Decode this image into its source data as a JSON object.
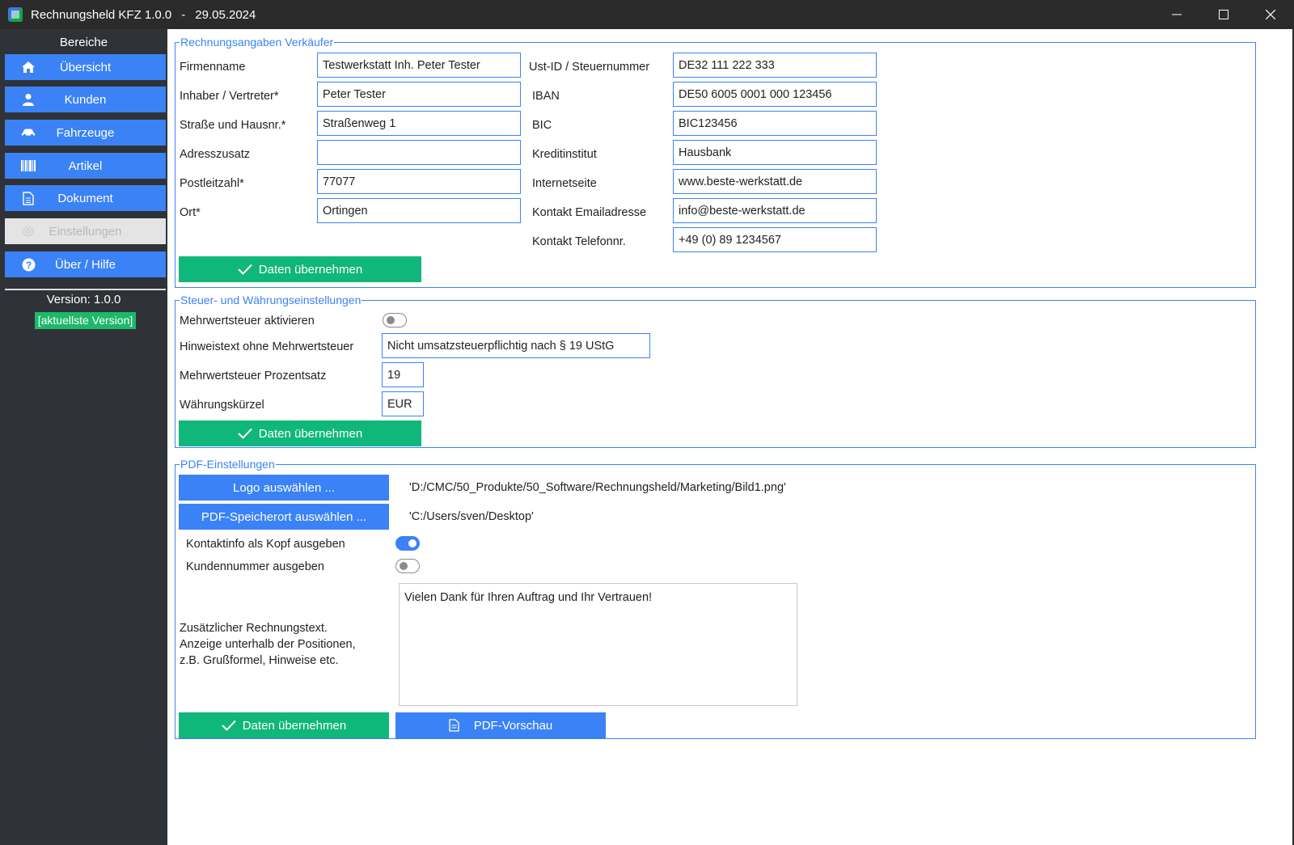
{
  "window": {
    "app_title": "Rechnungsheld KFZ 1.0.0",
    "separator": "-",
    "date": "29.05.2024"
  },
  "sidebar": {
    "heading": "Bereiche",
    "items": [
      {
        "label": "Übersicht",
        "icon": "home-icon"
      },
      {
        "label": "Kunden",
        "icon": "user-icon"
      },
      {
        "label": "Fahrzeuge",
        "icon": "car-icon"
      },
      {
        "label": "Artikel",
        "icon": "barcode-icon"
      },
      {
        "label": "Dokument",
        "icon": "document-icon"
      },
      {
        "label": "Einstellungen",
        "icon": "gear-icon"
      },
      {
        "label": "Über / Hilfe",
        "icon": "help-icon"
      }
    ],
    "version": "Version: 1.0.0",
    "version_status": "[aktuellste Version]"
  },
  "seller": {
    "legend": "Rechnungsangaben Verkäufer",
    "left_fields": [
      {
        "label": "Firmenname",
        "value": "Testwerkstatt Inh. Peter Tester"
      },
      {
        "label": "Inhaber / Vertreter*",
        "value": "Peter Tester"
      },
      {
        "label": "Straße und Hausnr.*",
        "value": "Straßenweg 1"
      },
      {
        "label": "Adresszusatz",
        "value": ""
      },
      {
        "label": "Postleitzahl*",
        "value": "77077"
      },
      {
        "label": "Ort*",
        "value": "Ortingen"
      }
    ],
    "right_fields": [
      {
        "label": "Ust-ID / Steuernummer",
        "value": "DE32 111 222 333"
      },
      {
        "label": "IBAN",
        "value": "DE50 6005 0001 000 123456"
      },
      {
        "label": "BIC",
        "value": "BIC123456"
      },
      {
        "label": "Kreditinstitut",
        "value": "Hausbank"
      },
      {
        "label": "Internetseite",
        "value": "www.beste-werkstatt.de"
      },
      {
        "label": "Kontakt Emailadresse",
        "value": "info@beste-werkstatt.de"
      },
      {
        "label": "Kontakt Telefonnr.",
        "value": "+49 (0) 89 1234567"
      }
    ],
    "apply_label": "Daten übernehmen"
  },
  "tax": {
    "legend": "Steuer- und Währungseinstellungen",
    "vat_enabled_label": "Mehrwertsteuer aktivieren",
    "vat_enabled": false,
    "note_label": "Hinweistext ohne Mehrwertsteuer",
    "note_value": "Nicht umsatzsteuerpflichtig nach § 19 UStG",
    "vat_rate_label": "Mehrwertsteuer Prozentsatz",
    "vat_rate_value": "19",
    "currency_label": "Währungskürzel",
    "currency_value": "EUR",
    "apply_label": "Daten übernehmen"
  },
  "pdf": {
    "legend": "PDF-Einstellungen",
    "logo_button": "Logo auswählen ...",
    "logo_path": "'D:/CMC/50_Produkte/50_Software/Rechnungsheld/Marketing/Bild1.png'",
    "save_button": "PDF-Speicherort auswählen ...",
    "save_path": "'C:/Users/sven/Desktop'",
    "contact_header_label": "Kontaktinfo als Kopf ausgeben",
    "contact_header_enabled": true,
    "customer_number_label": "Kundennummer ausgeben",
    "customer_number_enabled": false,
    "extra_text_label_line1": "Zusätzlicher Rechnungstext.",
    "extra_text_label_line2": "Anzeige unterhalb der Positionen,",
    "extra_text_label_line3": "z.B. Grußformel, Hinweise etc.",
    "extra_text_value": "Vielen Dank für Ihren Auftrag und Ihr Vertrauen!",
    "apply_label": "Daten übernehmen",
    "preview_label": "PDF-Vorschau"
  },
  "colors": {
    "accent_blue": "#3b82f6",
    "accent_green": "#10b77a",
    "sidebar_bg": "#2f3338"
  }
}
